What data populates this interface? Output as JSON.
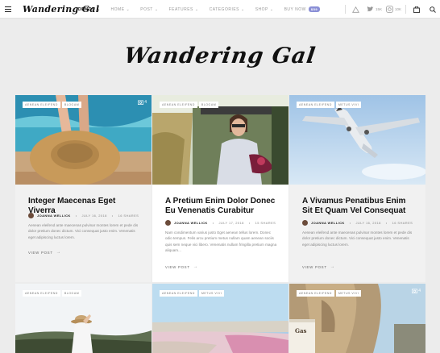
{
  "topbar": {
    "logo": "Wandering Gal",
    "nav": [
      {
        "label": "DEMOS",
        "active": true
      },
      {
        "label": "HOME",
        "active": false
      },
      {
        "label": "POST",
        "active": false
      },
      {
        "label": "FEATURES",
        "active": false
      },
      {
        "label": "CATEGORIES",
        "active": false
      },
      {
        "label": "SHOP",
        "active": false
      }
    ],
    "buy_label": "BUY NOW",
    "buy_badge": "$59",
    "twitter_count": "15K",
    "instagram_count": "10K"
  },
  "hero": {
    "title": "Wandering Gal"
  },
  "posts": [
    {
      "tags": [
        "AENEAN ELEIFEND",
        "BLOGAM"
      ],
      "gallery_count": "4",
      "title": "Integer Maecenas Eget Viverra",
      "author": "JOANNA WELLICK",
      "date": "JULY 16, 2018",
      "shares": "16 SHARES",
      "excerpt": "Aenean eleifend ante maecenas pulvinar montes lorem et pede dis dolor pretium donec dictum. Vici consequat justo enim. Venenatis eget adipiscing luctus lorem.",
      "view_post": "VIEW POST"
    },
    {
      "tags": [
        "AENEAN ELEIFEND",
        "BLOGAM"
      ],
      "title": "A Pretium Enim Dolor Donec Eu Venenatis Curabitur",
      "author": "JOANNA WELLICK",
      "date": "JULY 17, 2018",
      "shares": "15 SHARES",
      "excerpt": "Nam condimentum varius justo Eget aenean tellus lorem. Donec odio tempus. Felis arcu pretium metus nullam quam aenean sociis quis sem neque vici libero. Venenatis nullam fringilla pretium magna aliquam...",
      "view_post": "VIEW POST"
    },
    {
      "tags": [
        "AENEAN ELEIFEND",
        "METUS VIVI"
      ],
      "title": "A Vivamus Penatibus Enim Sit Et Quam Vel Consequat",
      "author": "JOANNA WELLICK",
      "date": "JULY 16, 2018",
      "shares": "16 SHARES",
      "excerpt": "Aenean eleifend ante maecenas pulvinar montes lorem et pede dis dolor pretium donec dictum. Vici consequat justo enim. Venenatis eget adipiscing luctus lorem.",
      "view_post": "VIEW POST"
    },
    {
      "tags": [
        "AENEAN ELEIFEND",
        "BLOGAM"
      ]
    },
    {
      "tags": [
        "AENEAN ELEIFEND",
        "METUS VIVI"
      ]
    },
    {
      "tags": [
        "AENEAN ELEIFEND",
        "METUS VIVI"
      ],
      "gallery_count": "4",
      "sign": "Gas"
    }
  ]
}
